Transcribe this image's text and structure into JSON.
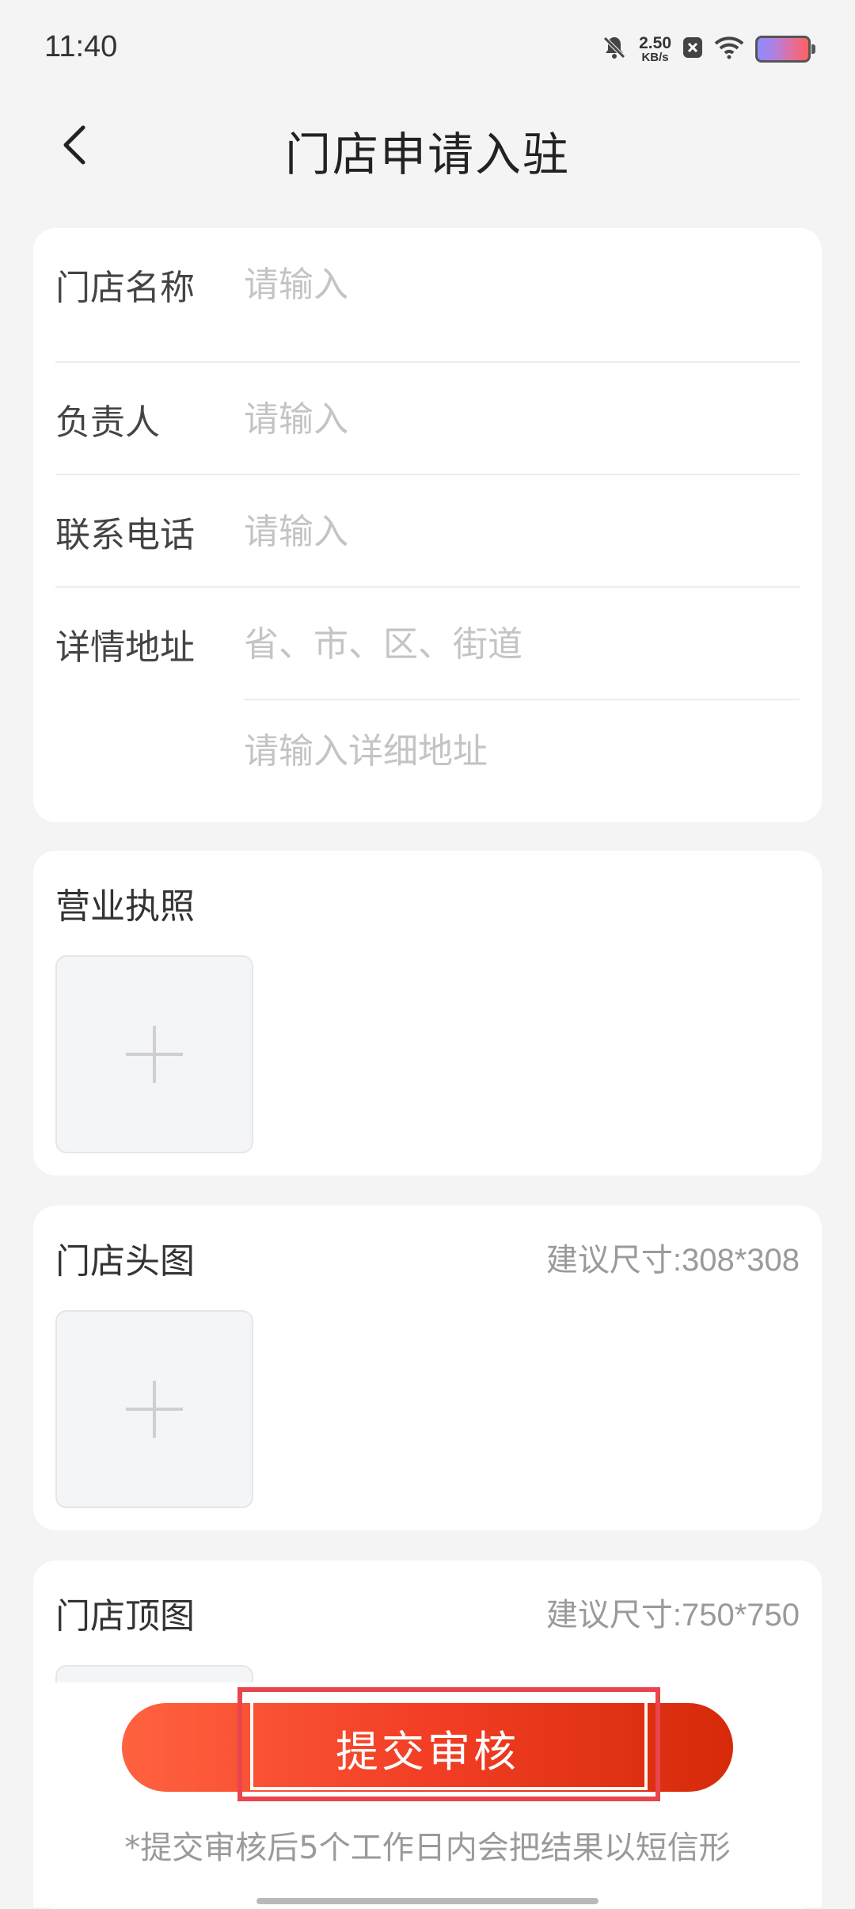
{
  "status_bar": {
    "time": "11:40",
    "net_speed_value": "2.50",
    "net_speed_unit": "KB/s",
    "icons": [
      "bell-off-icon",
      "close-box-icon",
      "wifi-icon",
      "battery-icon"
    ]
  },
  "nav": {
    "title": "门店申请入驻",
    "back_icon": "chevron-left-icon"
  },
  "form": {
    "store_name": {
      "label": "门店名称",
      "placeholder": "请输入",
      "value": ""
    },
    "manager": {
      "label": "负责人",
      "placeholder": "请输入",
      "value": ""
    },
    "phone": {
      "label": "联系电话",
      "placeholder": "请输入",
      "value": ""
    },
    "address": {
      "label": "详情地址",
      "region_placeholder": "省、市、区、街道",
      "detail_placeholder": "请输入详细地址"
    }
  },
  "uploads": {
    "license": {
      "title": "营业执照"
    },
    "head_image": {
      "title": "门店头图",
      "hint": "建议尺寸:308*308"
    },
    "top_image": {
      "title": "门店顶图",
      "hint": "建议尺寸:750*750"
    }
  },
  "footer": {
    "submit_label": "提交审核",
    "note": "*提交审核后5个工作日内会把结果以短信形"
  },
  "colors": {
    "background": "#f4f4f5",
    "primary_gradient_start": "#ff6240",
    "primary_gradient_end": "#d62a0a",
    "highlight": "#e8454e",
    "placeholder": "#c4c4c4"
  }
}
